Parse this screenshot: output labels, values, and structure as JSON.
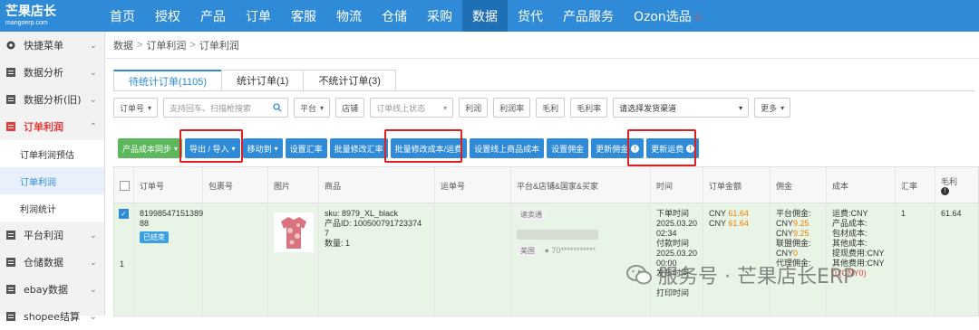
{
  "brand": {
    "name": "芒果店长",
    "url": "mangoerp.com"
  },
  "topnav": {
    "items": [
      "首页",
      "授权",
      "产品",
      "订单",
      "客服",
      "物流",
      "仓储",
      "采购",
      "数据",
      "货代",
      "产品服务",
      "Ozon选品"
    ],
    "active": "数据"
  },
  "sidebar": {
    "items": [
      {
        "label": "快捷菜单",
        "icon": "gear-icon"
      },
      {
        "label": "数据分析",
        "icon": "report-icon"
      },
      {
        "label": "数据分析(旧)",
        "icon": "report-icon"
      },
      {
        "label": "订单利润",
        "icon": "report-icon",
        "open": true
      },
      {
        "label": "订单利润预估",
        "sub": true
      },
      {
        "label": "订单利润",
        "sub": true,
        "active": true
      },
      {
        "label": "利润统计",
        "sub": true
      },
      {
        "label": "平台利润",
        "icon": "report-icon"
      },
      {
        "label": "仓储数据",
        "icon": "report-icon"
      },
      {
        "label": "ebay数据",
        "icon": "report-icon"
      },
      {
        "label": "shopee结算",
        "icon": "report-icon"
      }
    ]
  },
  "breadcrumb": [
    "数据",
    "订单利润",
    "订单利润"
  ],
  "tabs": [
    "待统计订单(1105)",
    "统计订单(1)",
    "不统计订单(3)"
  ],
  "filters": {
    "order_no": "订单号",
    "search_placeholder": "支持回车、扫描枪搜索",
    "platform": "平台",
    "shop": "店铺",
    "online_status": "订单线上状态",
    "profit": "利润",
    "profit_rate": "利润率",
    "gross": "毛利",
    "gross_rate": "毛利率",
    "channel_placeholder": "请选择发货渠道",
    "more": "更多"
  },
  "actions": {
    "cost_sync": "产品成本同步",
    "export_import": "导出 / 导入",
    "move_to": "移动到",
    "set_rate": "设置汇率",
    "batch_rate": "批量修改汇率",
    "batch_cost": "批量修改成本/运费",
    "set_online_cost": "设置线上商品成本",
    "set_commission": "设置佣金",
    "update_commission": "更新佣金",
    "update_freight": "更新运费"
  },
  "table": {
    "headers": [
      "订单号",
      "包裹号",
      "图片",
      "商品",
      "运单号",
      "平台&店铺&国家&买家",
      "时间",
      "订单金额",
      "佣金",
      "成本",
      "汇率",
      "毛利"
    ],
    "row": {
      "order_no": [
        "81998547151389",
        "88"
      ],
      "status": "已结束",
      "index": "1",
      "sku": "sku: 8979_XL_black",
      "product_id": [
        "产品ID: 100500791723374",
        "7"
      ],
      "qty": "数量: 1",
      "platform": "速卖通",
      "buyer_masked": "",
      "country": "美国",
      "buyer_id": "70***********",
      "times": [
        "下单时间",
        "2025.03.20",
        "02:34",
        "付款时间",
        "2025.03.20",
        "00:00",
        "发货时间",
        "",
        "打印时间"
      ],
      "amount_label": "CNY ",
      "amount_1": "61.64",
      "amount_2": "61.64",
      "commission": [
        {
          "label": "平台佣金:",
          "prefix": "CNY",
          "value": "9.25"
        },
        {
          "label": "",
          "prefix": "CNY",
          "value": "9.25"
        },
        {
          "label": "联盟佣金:",
          "prefix": "",
          "value": ""
        },
        {
          "label": "CNY",
          "prefix": "",
          "value": "0"
        },
        {
          "label": "代理佣金:",
          "prefix": "",
          "value": ""
        },
        {
          "label": "CNY",
          "prefix": "",
          "value": "0"
        }
      ],
      "costs": [
        "运费:CNY",
        "产品成本:",
        "包材成本:",
        "其他成本:",
        "提现费用:CNY",
        "其他费用:CNY",
        "0 (CNY0)"
      ],
      "rate": "1",
      "gross": "61.64"
    }
  },
  "watermark": "服务号 · 芒果店长ERP",
  "colors": {
    "nav": "#2f8bd7",
    "highlight": "#e02020",
    "row_bg": "#e8f4e5"
  }
}
